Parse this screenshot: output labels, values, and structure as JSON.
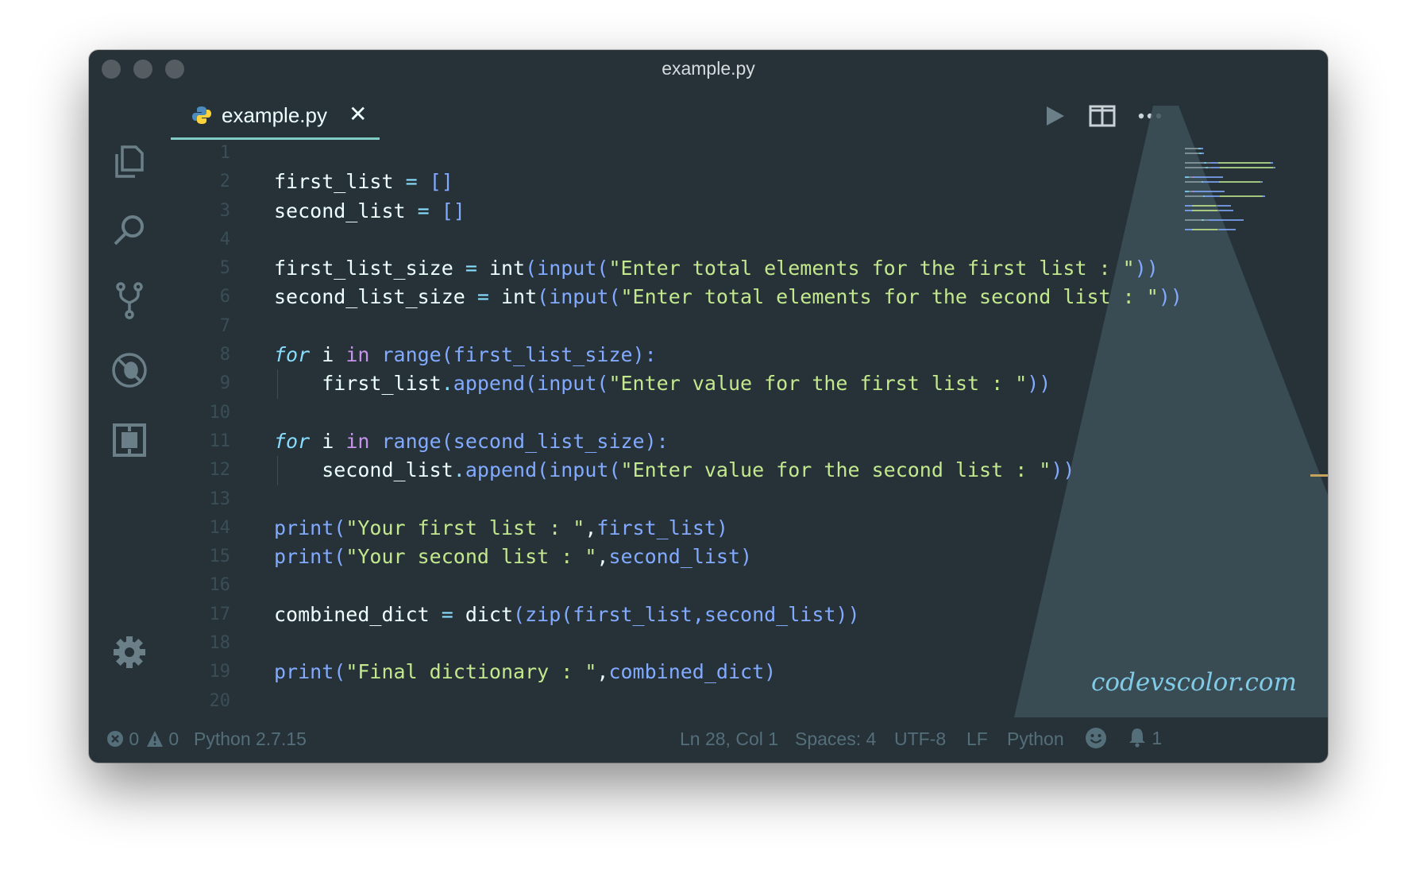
{
  "window": {
    "title": "example.py"
  },
  "tab": {
    "label": "example.py",
    "close": "✕"
  },
  "activity_bar": [
    "explorer-icon",
    "search-icon",
    "source-control-icon",
    "debug-icon",
    "extensions-icon",
    "settings-gear-icon"
  ],
  "toolbar": [
    "run-icon",
    "split-editor-icon",
    "more-actions-icon"
  ],
  "editor": {
    "line_numbers": [
      "1",
      "2",
      "3",
      "4",
      "5",
      "6",
      "7",
      "8",
      "9",
      "10",
      "11",
      "12",
      "13",
      "14",
      "15",
      "16",
      "17",
      "18",
      "19",
      "20"
    ],
    "lines": [
      {
        "indent": false,
        "tokens": []
      },
      {
        "indent": false,
        "tokens": [
          [
            "var",
            "first_list "
          ],
          [
            "op",
            "= "
          ],
          [
            "fn",
            "[]"
          ]
        ]
      },
      {
        "indent": false,
        "tokens": [
          [
            "var",
            "second_list "
          ],
          [
            "op",
            "= "
          ],
          [
            "fn",
            "[]"
          ]
        ]
      },
      {
        "indent": false,
        "tokens": []
      },
      {
        "indent": false,
        "tokens": [
          [
            "var",
            "first_list_size "
          ],
          [
            "op",
            "= "
          ],
          [
            "var",
            "int"
          ],
          [
            "fn",
            "(input("
          ],
          [
            "str",
            "\"Enter total elements for the first list : \""
          ],
          [
            "fn",
            "))"
          ]
        ]
      },
      {
        "indent": false,
        "tokens": [
          [
            "var",
            "second_list_size "
          ],
          [
            "op",
            "= "
          ],
          [
            "var",
            "int"
          ],
          [
            "fn",
            "(input("
          ],
          [
            "str",
            "\"Enter total elements for the second list : \""
          ],
          [
            "fn",
            "))"
          ]
        ]
      },
      {
        "indent": false,
        "tokens": []
      },
      {
        "indent": false,
        "tokens": [
          [
            "it",
            "for"
          ],
          [
            "var",
            " i "
          ],
          [
            "kw",
            "in"
          ],
          [
            "fn",
            " range(first_list_size):"
          ]
        ]
      },
      {
        "indent": true,
        "tokens": [
          [
            "var",
            "    first_list"
          ],
          [
            "op",
            "."
          ],
          [
            "fn",
            "append(input("
          ],
          [
            "str",
            "\"Enter value for the first list : \""
          ],
          [
            "fn",
            "))"
          ]
        ]
      },
      {
        "indent": false,
        "tokens": []
      },
      {
        "indent": false,
        "tokens": [
          [
            "it",
            "for"
          ],
          [
            "var",
            " i "
          ],
          [
            "kw",
            "in"
          ],
          [
            "fn",
            " range(second_list_size):"
          ]
        ]
      },
      {
        "indent": true,
        "tokens": [
          [
            "var",
            "    second_list"
          ],
          [
            "op",
            "."
          ],
          [
            "fn",
            "append(input("
          ],
          [
            "str",
            "\"Enter value for the second list : \""
          ],
          [
            "fn",
            "))"
          ]
        ]
      },
      {
        "indent": false,
        "tokens": []
      },
      {
        "indent": false,
        "tokens": [
          [
            "fn",
            "print("
          ],
          [
            "str",
            "\"Your first list : \""
          ],
          [
            "var",
            ","
          ],
          [
            "fn",
            "first_list)"
          ]
        ]
      },
      {
        "indent": false,
        "tokens": [
          [
            "fn",
            "print("
          ],
          [
            "str",
            "\"Your second list : \""
          ],
          [
            "var",
            ","
          ],
          [
            "fn",
            "second_list)"
          ]
        ]
      },
      {
        "indent": false,
        "tokens": []
      },
      {
        "indent": false,
        "tokens": [
          [
            "var",
            "combined_dict "
          ],
          [
            "op",
            "= "
          ],
          [
            "var",
            "dict"
          ],
          [
            "fn",
            "(zip(first_list,second_list))"
          ]
        ]
      },
      {
        "indent": false,
        "tokens": []
      },
      {
        "indent": false,
        "tokens": [
          [
            "fn",
            "print("
          ],
          [
            "str",
            "\"Final dictionary : \""
          ],
          [
            "var",
            ","
          ],
          [
            "fn",
            "combined_dict)"
          ]
        ]
      },
      {
        "indent": false,
        "tokens": []
      }
    ]
  },
  "watermark": "codevscolor.com",
  "status": {
    "errors": "0",
    "warnings": "0",
    "interpreter": "Python 2.7.15",
    "position": "Ln 28, Col 1",
    "spaces": "Spaces: 4",
    "encoding": "UTF-8",
    "eol": "LF",
    "language": "Python",
    "notifications": "1"
  },
  "colors": {
    "background": "#263238",
    "accent": "#80cbc4",
    "string": "#c3e88d",
    "function": "#82aaff",
    "operator": "#89ddff",
    "keyword": "#c792ea",
    "foreground": "#eeffff",
    "status_text": "#546e7a",
    "line_number": "#3b4d56",
    "scroll_marker": "#c5a35a"
  }
}
